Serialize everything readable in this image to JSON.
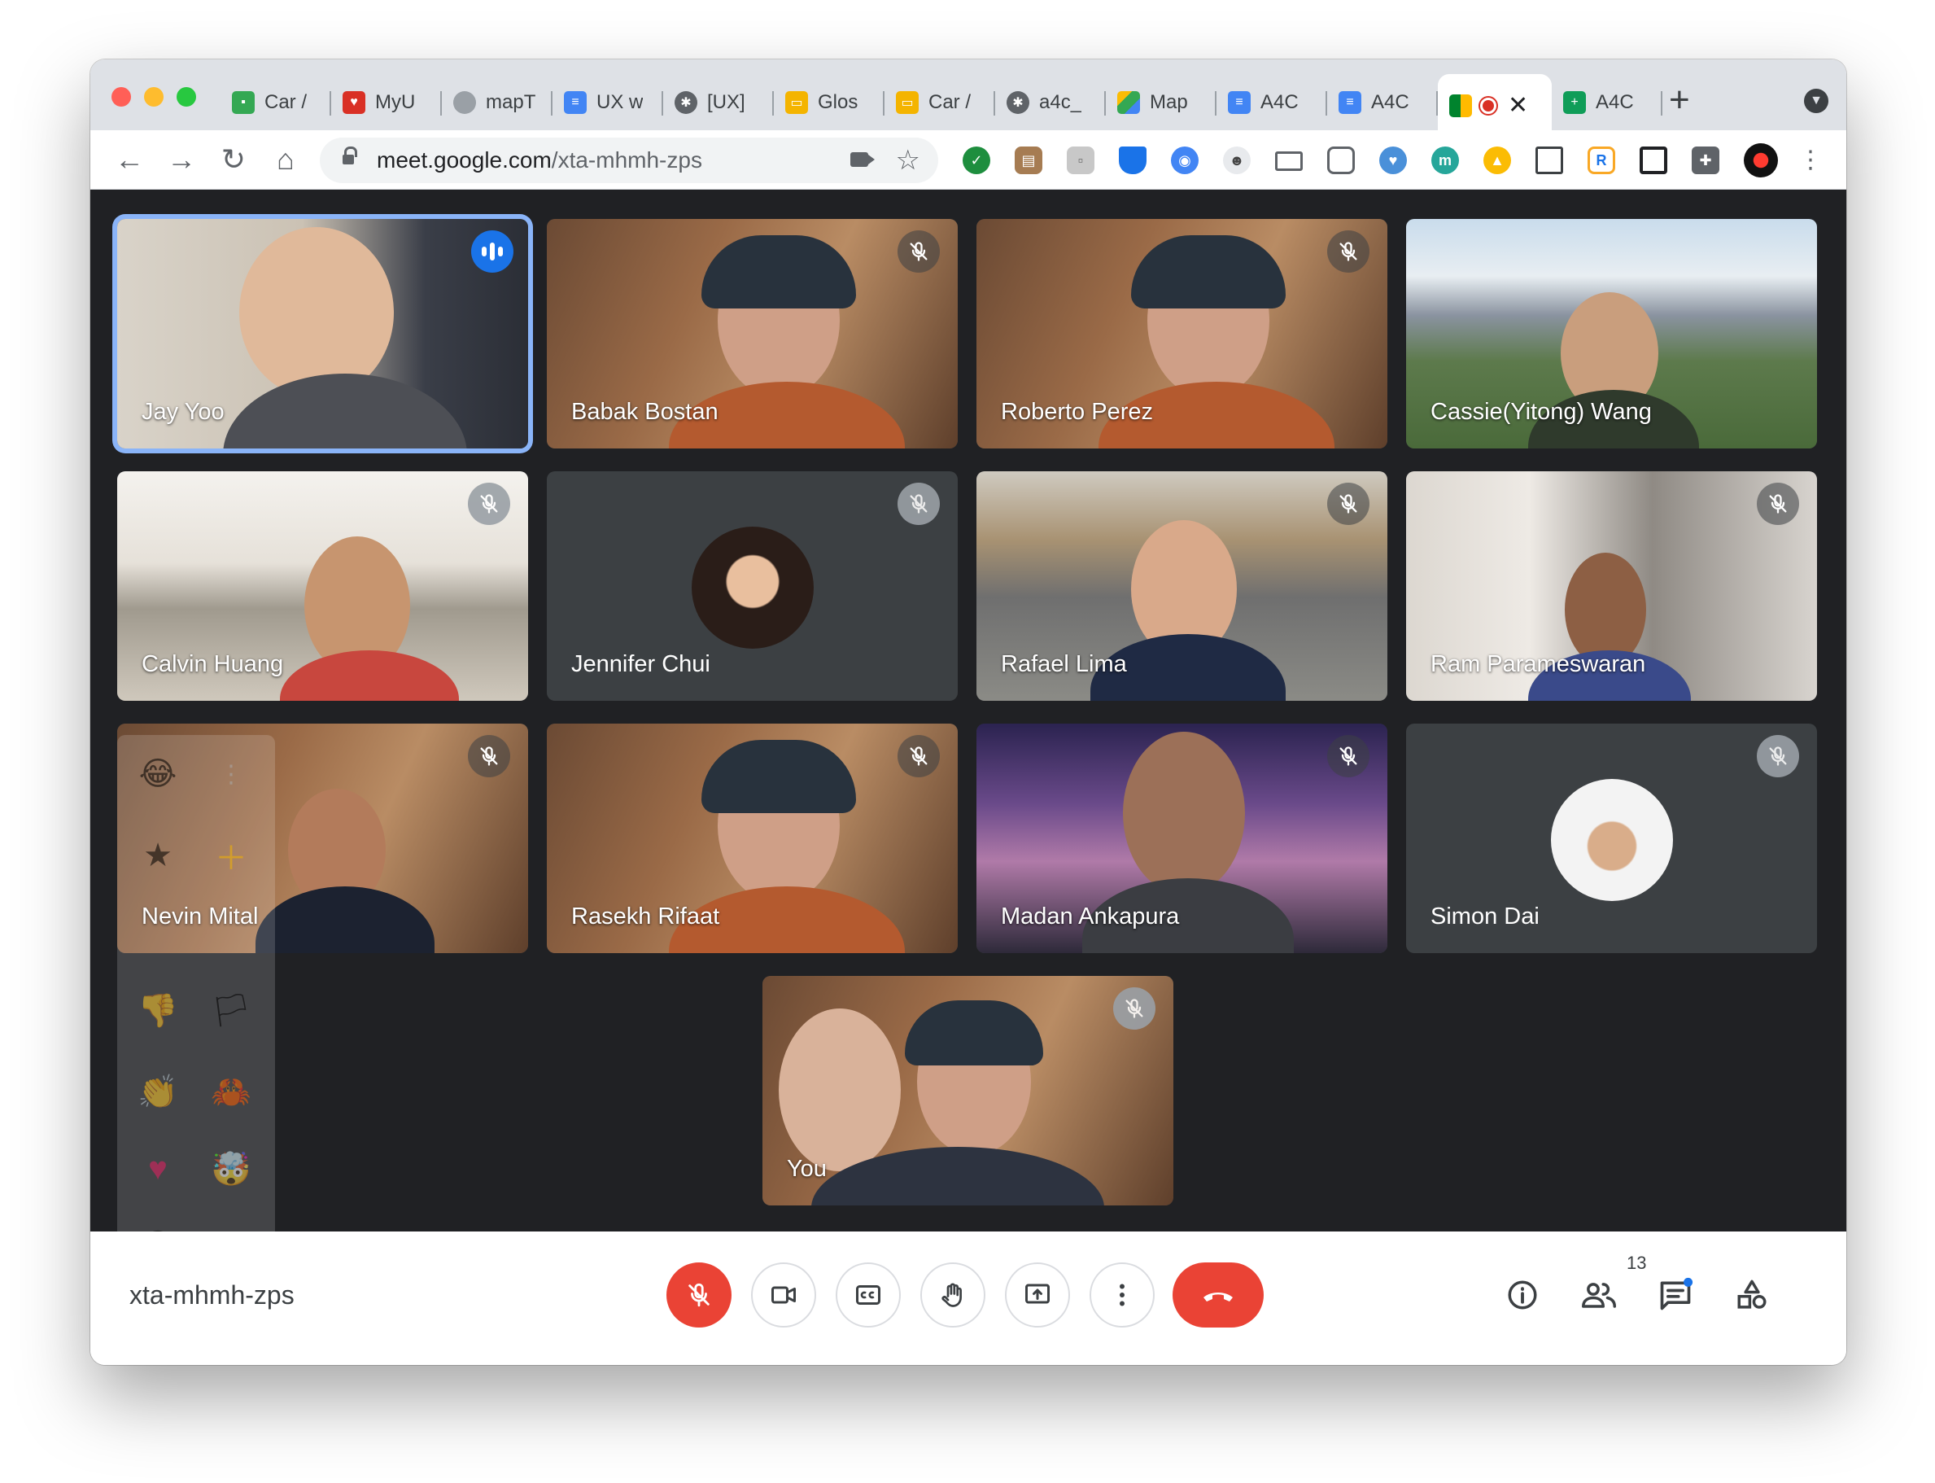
{
  "browser": {
    "tabs": [
      {
        "title": "Car /",
        "icon": "chat-icon",
        "color": "#34a853"
      },
      {
        "title": "MyU",
        "icon": "calendar-heart-icon",
        "color": "#d93025"
      },
      {
        "title": "mapT",
        "icon": "apple-icon",
        "color": "#555555"
      },
      {
        "title": "UX w",
        "icon": "docs-icon",
        "color": "#4285f4"
      },
      {
        "title": "[UX]",
        "icon": "bug-icon",
        "color": "#5f6368"
      },
      {
        "title": "Glos",
        "icon": "slides-icon",
        "color": "#f4b400"
      },
      {
        "title": "Car /",
        "icon": "slides-icon",
        "color": "#f4b400"
      },
      {
        "title": "a4c_",
        "icon": "bug-icon",
        "color": "#5f6368"
      },
      {
        "title": "Map",
        "icon": "drive-icon",
        "color": "#34a853"
      },
      {
        "title": "A4C",
        "icon": "docs-icon",
        "color": "#4285f4"
      },
      {
        "title": "A4C",
        "icon": "docs-icon",
        "color": "#4285f4"
      }
    ],
    "active_tab": {
      "icon": "meet-icon",
      "close": "✕"
    },
    "last_tab": {
      "title": "A4C",
      "icon": "sheets-icon",
      "color": "#0f9d58"
    },
    "new_tab": "+",
    "url_host": "meet.google.com",
    "url_path": "/xta-mhmh-zps"
  },
  "participants": [
    {
      "name": "Jay Yoo",
      "status": "speaking"
    },
    {
      "name": "Babak Bostan",
      "status": "muted"
    },
    {
      "name": "Roberto Perez",
      "status": "muted"
    },
    {
      "name": "Cassie(Yitong) Wang",
      "status": "none"
    },
    {
      "name": "Calvin Huang",
      "status": "muted"
    },
    {
      "name": "Jennifer Chui",
      "status": "muted"
    },
    {
      "name": "Rafael Lima",
      "status": "muted"
    },
    {
      "name": "Ram Parameswaran",
      "status": "muted"
    },
    {
      "name": "Nevin Mital",
      "status": "muted"
    },
    {
      "name": "Rasekh Rifaat",
      "status": "muted"
    },
    {
      "name": "Madan Ankapura",
      "status": "muted"
    },
    {
      "name": "Simon Dai",
      "status": "muted"
    },
    {
      "name": "You",
      "status": "muted"
    }
  ],
  "meeting": {
    "code": "xta-mhmh-zps",
    "participant_count": "13"
  },
  "colors": {
    "meet_bg": "#202124",
    "tile_bg": "#3c4043",
    "speaking_ring": "#8ab4f8",
    "red": "#ea4335",
    "blue": "#1a73e8"
  }
}
